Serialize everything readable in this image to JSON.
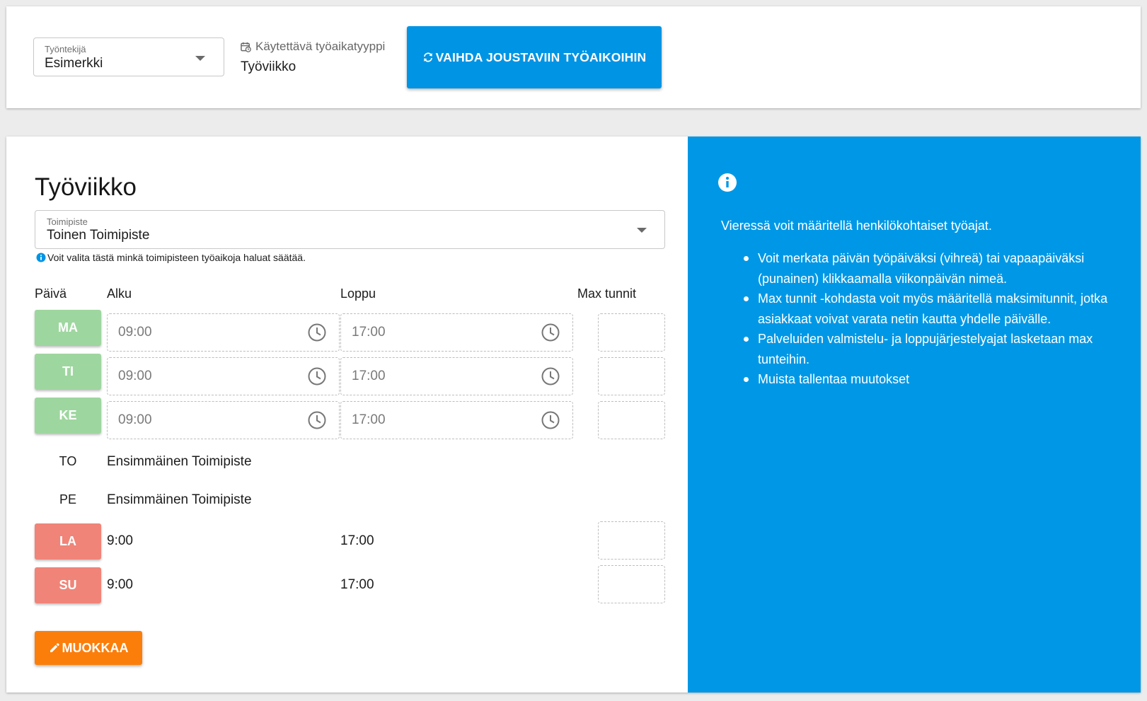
{
  "header": {
    "employee_select": {
      "label": "Työntekijä",
      "value": "Esimerkki"
    },
    "worktime_type": {
      "label": "Käytettävä työaikatyyppi",
      "value": "Työviikko"
    },
    "switch_button": {
      "label": "VAIHDA JOUSTAVIIN TYÖAIKOIHIN"
    }
  },
  "schedule": {
    "title": "Työviikko",
    "location_select": {
      "label": "Toimipiste",
      "value": "Toinen Toimipiste"
    },
    "location_help": "Voit valita tästä minkä toimipisteen työaikoja haluat säätää.",
    "columns": {
      "day": "Päivä",
      "start": "Alku",
      "end": "Loppu",
      "max": "Max tunnit"
    },
    "days": [
      {
        "day": "MA",
        "state": "working",
        "start": "09:00",
        "end": "17:00",
        "max": ""
      },
      {
        "day": "TI",
        "state": "working",
        "start": "09:00",
        "end": "17:00",
        "max": ""
      },
      {
        "day": "KE",
        "state": "working",
        "start": "09:00",
        "end": "17:00",
        "max": ""
      },
      {
        "day": "TO",
        "state": "other-location",
        "location": "Ensimmäinen Toimipiste"
      },
      {
        "day": "PE",
        "state": "other-location",
        "location": "Ensimmäinen Toimipiste"
      },
      {
        "day": "LA",
        "state": "off",
        "start": "9:00",
        "end": "17:00",
        "max": ""
      },
      {
        "day": "SU",
        "state": "off",
        "start": "9:00",
        "end": "17:00",
        "max": ""
      }
    ],
    "edit_button": {
      "label": "MUOKKAA"
    }
  },
  "info": {
    "intro": "Vieressä voit määritellä henkilökohtaiset työajat.",
    "bullets": [
      "Voit merkata päivän työpäiväksi (vihreä) tai vapaapäiväksi (punainen) klikkaamalla viikonpäivän nimeä.",
      "Max tunnit -kohdasta voit myös määritellä maksimitunnit, jotka asiakkaat voivat varata netin kautta yhdelle päivälle.",
      "Palveluiden valmistelu- ja loppujärjestelyajat lasketaan max tunteihin.",
      "Muista tallentaa muutokset"
    ]
  },
  "colors": {
    "primary": "#0094e4",
    "info_panel": "#0098e6",
    "working_day": "#9ed69f",
    "off_day": "#f08478",
    "edit_button": "#fb7e0b"
  },
  "icons": {
    "worktime_type": "calendar-clock-icon",
    "switch": "sync-icon",
    "help": "info-circle-icon",
    "time": "clock-icon",
    "edit": "pencil-icon",
    "info_panel": "info-icon"
  }
}
